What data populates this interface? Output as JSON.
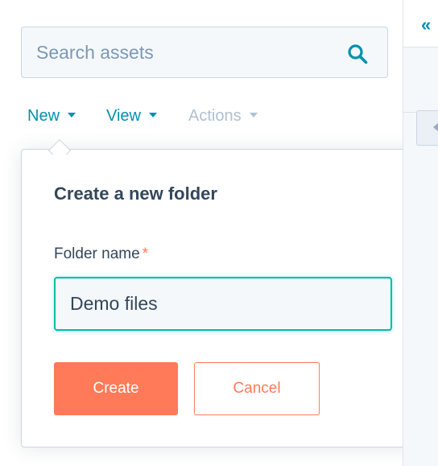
{
  "search": {
    "placeholder": "Search assets",
    "icon": "search-icon"
  },
  "menu": {
    "new_label": "New",
    "view_label": "View",
    "actions_label": "Actions"
  },
  "dialog": {
    "title": "Create a new folder",
    "field_label": "Folder name",
    "required_marker": "*",
    "folder_name_value": "Demo files",
    "create_label": "Create",
    "cancel_label": "Cancel"
  },
  "right_panel": {
    "collapse_icon": "double-chevron-left-icon",
    "collapse_glyph": "«"
  },
  "colors": {
    "accent_link": "#0091ae",
    "primary_button": "#ff7a59",
    "focus_border": "#00bda5",
    "text": "#33475b",
    "disabled_text": "#b0c1d4"
  }
}
